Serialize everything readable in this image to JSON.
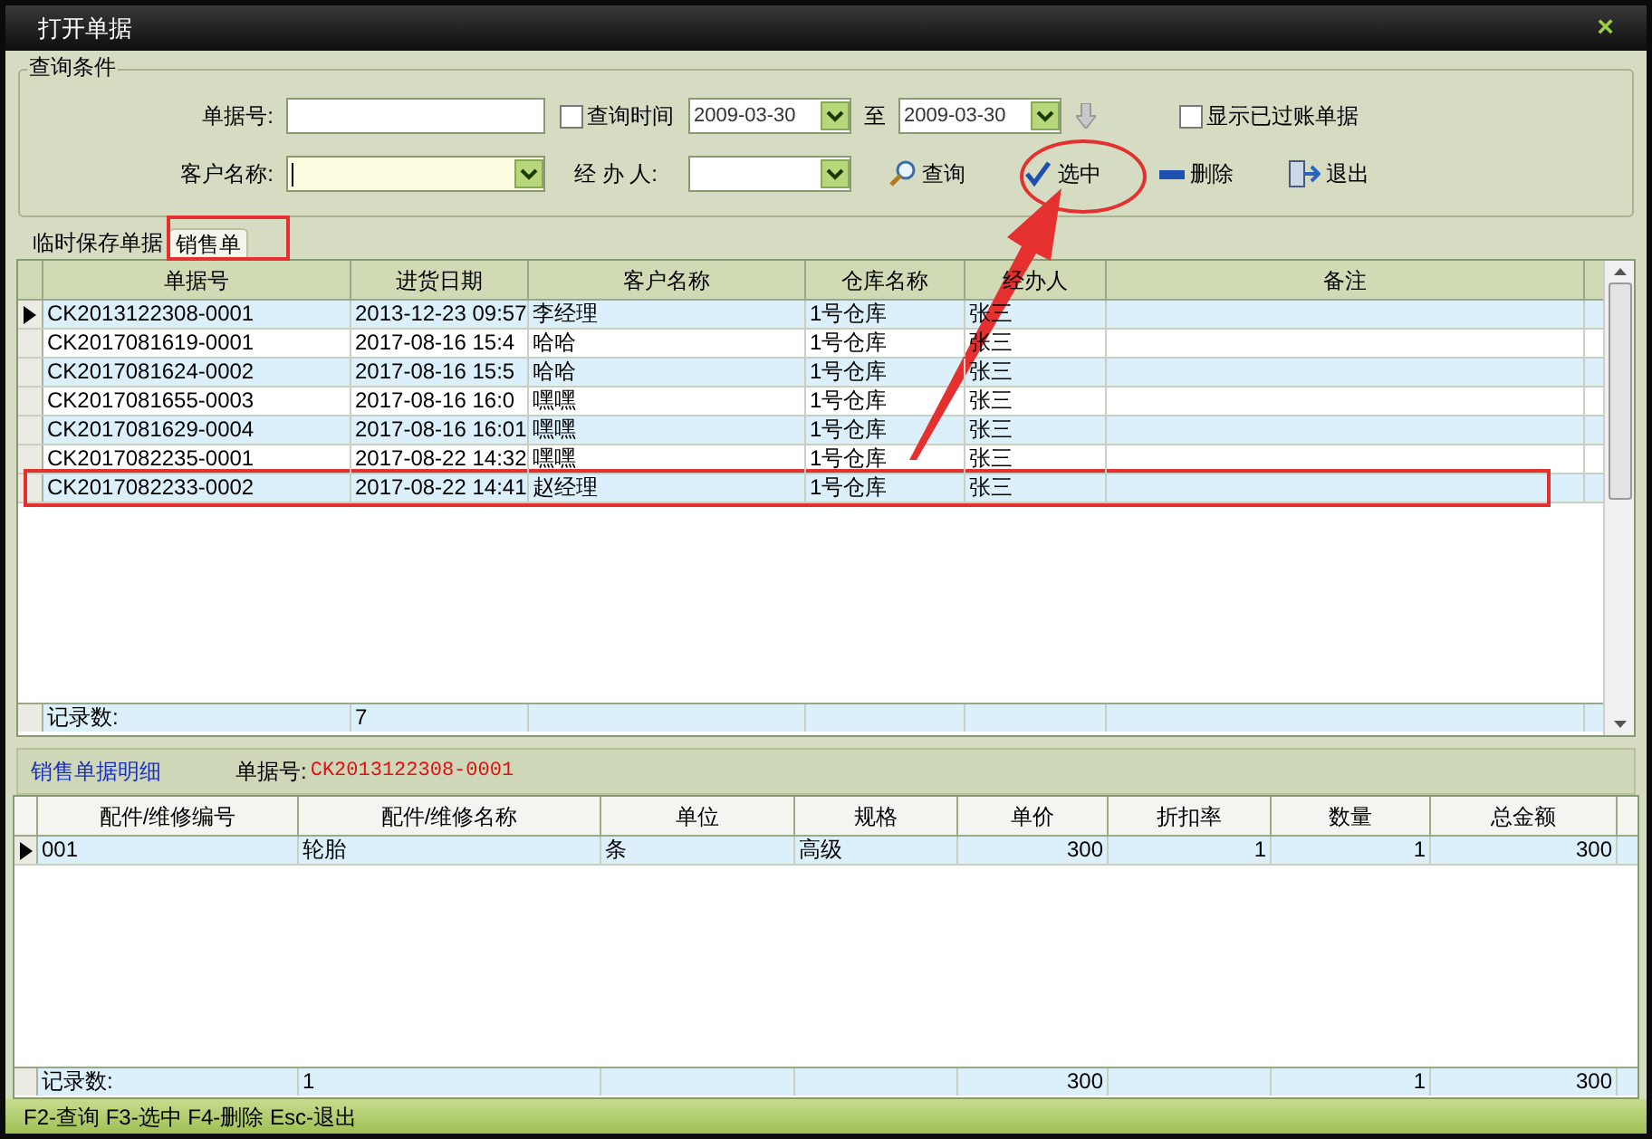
{
  "window": {
    "title": "打开单据",
    "close": "×"
  },
  "query": {
    "legend": "查询条件",
    "doc_no": {
      "label": "单据号:"
    },
    "query_time": {
      "label": "查询时间",
      "checked": false
    },
    "date_from": {
      "value": "2009-03-30"
    },
    "to_label": "至",
    "date_to": {
      "value": "2009-03-30"
    },
    "show_posted": {
      "label": "显示已过账单据",
      "checked": false
    },
    "customer": {
      "label": "客户名称:",
      "focused": true
    },
    "handler": {
      "label": "经 办 人:",
      "focused": false
    },
    "buttons": [
      {
        "kind": "search",
        "label": "查询"
      },
      {
        "kind": "check",
        "label": "选中"
      },
      {
        "kind": "minus",
        "label": "删除"
      },
      {
        "kind": "exit",
        "label": "退出"
      }
    ]
  },
  "tabs": [
    {
      "label": "临时保存单据",
      "selected": false
    },
    {
      "label": "销售单",
      "selected": true
    }
  ],
  "orders": {
    "columns": [
      "单据号",
      "进货日期",
      "客户名称",
      "仓库名称",
      "经办人",
      "备注"
    ],
    "rows": [
      {
        "cells": [
          "CK2013122308-0001",
          "2013-12-23 09:57",
          "李经理",
          "1号仓库",
          "张三"
        ],
        "selected": true
      },
      {
        "cells": [
          "CK2017081619-0001",
          "2017-08-16 15:4",
          "哈哈",
          "1号仓库",
          "张三"
        ],
        "selected": false
      },
      {
        "cells": [
          "CK2017081624-0002",
          "2017-08-16 15:5",
          "哈哈",
          "1号仓库",
          "张三"
        ],
        "selected": false
      },
      {
        "cells": [
          "CK2017081655-0003",
          "2017-08-16 16:0",
          "嘿嘿",
          "1号仓库",
          "张三"
        ],
        "selected": false
      },
      {
        "cells": [
          "CK2017081629-0004",
          "2017-08-16 16:01",
          "嘿嘿",
          "1号仓库",
          "张三"
        ],
        "selected": false
      },
      {
        "cells": [
          "CK2017082235-0001",
          "2017-08-22 14:32",
          "嘿嘿",
          "1号仓库",
          "张三"
        ],
        "selected": false
      },
      {
        "cells": [
          "CK2017082233-0002",
          "2017-08-22 14:41",
          "赵经理",
          "1号仓库",
          "张三"
        ],
        "selected": false
      }
    ],
    "footer": [
      {
        "kind": "text",
        "text": "记录数:"
      },
      {
        "kind": "text",
        "text": "7"
      },
      {
        "kind": "empty"
      },
      {
        "kind": "empty"
      },
      {
        "kind": "empty"
      },
      {
        "kind": "empty"
      }
    ]
  },
  "detail": {
    "title": "销售单据明细",
    "doc_label": "单据号:",
    "doc_no": "CK2013122308-0001",
    "columns": [
      "配件/维修编号",
      "配件/维修名称",
      "单位",
      "规格",
      "单价",
      "折扣率",
      "数量",
      "总金额"
    ],
    "rows": [
      {
        "cells": [
          "001",
          "轮胎",
          "条",
          "高级",
          "300",
          "1",
          "1",
          "300"
        ],
        "selected": true
      }
    ],
    "footer": [
      {
        "kind": "text",
        "text": "记录数:"
      },
      {
        "kind": "text",
        "text": "1"
      },
      {
        "kind": "empty"
      },
      {
        "kind": "empty"
      },
      {
        "kind": "text",
        "text": "300"
      },
      {
        "kind": "empty"
      },
      {
        "kind": "text",
        "text": "1"
      },
      {
        "kind": "text",
        "text": "300"
      }
    ]
  },
  "status_bar": "F2-查询 F3-选中 F4-删除 Esc-退出",
  "annotations": [
    {
      "kind": "ellipse"
    },
    {
      "kind": "frame"
    },
    {
      "kind": "frame"
    },
    {
      "kind": "arrow"
    }
  ]
}
